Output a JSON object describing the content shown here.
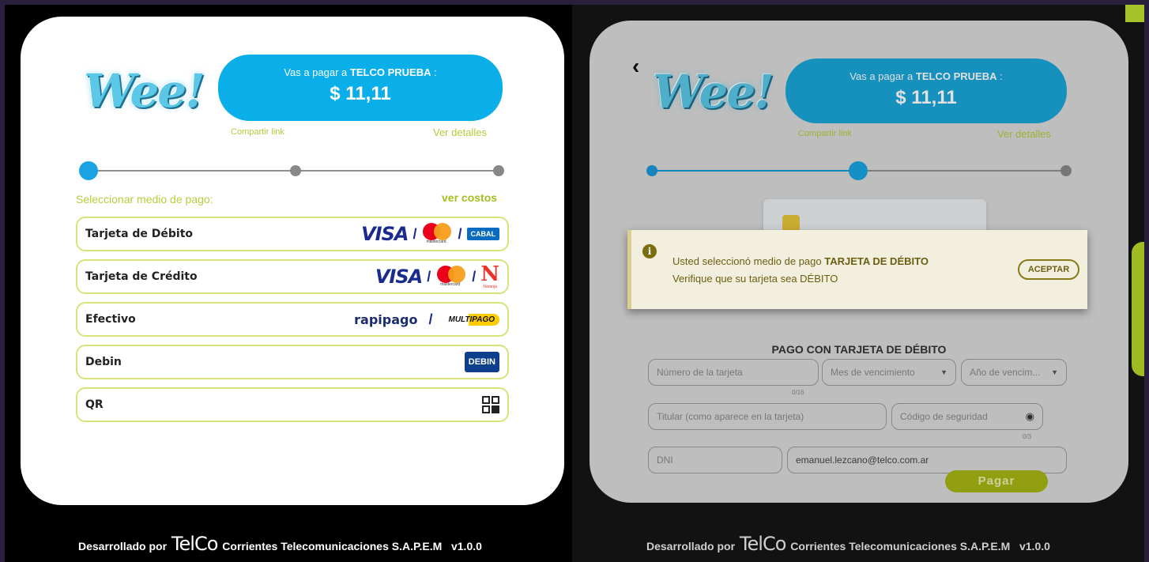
{
  "left": {
    "logo": "Wee!",
    "pay_prefix": "Vas a pagar a",
    "merchant": "TELCO PRUEBA",
    "pay_suffix": " :",
    "amount": "$ 11,11",
    "share_link": "Compartir link",
    "details_link": "Ver detalles",
    "section_label": "Seleccionar medio de pago:",
    "costs_link": "ver costos",
    "options": [
      {
        "label": "Tarjeta de Débito",
        "brands": [
          "VISA",
          "/",
          "/",
          "CABAL"
        ]
      },
      {
        "label": "Tarjeta de Crédito",
        "brands": [
          "VISA",
          "/",
          "/",
          "N",
          "Naranja"
        ]
      },
      {
        "label": "Efectivo",
        "brands": [
          "rapipago",
          "/",
          "MULTIPAGO"
        ]
      },
      {
        "label": "Debin",
        "brands": [
          "DEBIN"
        ]
      },
      {
        "label": "QR",
        "brands": []
      }
    ],
    "mastercard_text": "mastercard"
  },
  "right": {
    "logo": "Wee!",
    "pay_prefix": "Vas a pagar a",
    "merchant": "TELCO PRUEBA",
    "pay_suffix": " :",
    "amount": "$ 11,11",
    "share_link": "Compartir link",
    "details_link": "Ver detalles",
    "alert": {
      "line1_prefix": "Usted seleccionó medio de pago ",
      "line1_bold": "TARJETA DE DÉBITO",
      "line2": "Verifique que su tarjeta sea DÉBITO",
      "button": "ACEPTAR"
    },
    "form_title": "PAGO CON TARJETA DE DÉBITO",
    "fields": {
      "card_number": "Número de la tarjeta",
      "card_counter": "0/16",
      "exp_month": "Mes de vencimiento",
      "exp_year": "Año de vencim...",
      "holder": "Titular (como aparece en la tarjeta)",
      "security_code": "Código de seguridad",
      "security_counter": "0/3",
      "dni": "DNI",
      "email": "emanuel.lezcano@telco.com.ar"
    },
    "pay_button": "Pagar"
  },
  "footer": {
    "prefix": "Desarrollado por",
    "brand": "TelCo",
    "company": "Corrientes Telecomunicaciones S.A.P.E.M",
    "version": "v1.0.0"
  },
  "colors": {
    "accent_blue": "#0aaee8",
    "accent_green": "#a6c32a",
    "background": "#2a1f3d"
  }
}
